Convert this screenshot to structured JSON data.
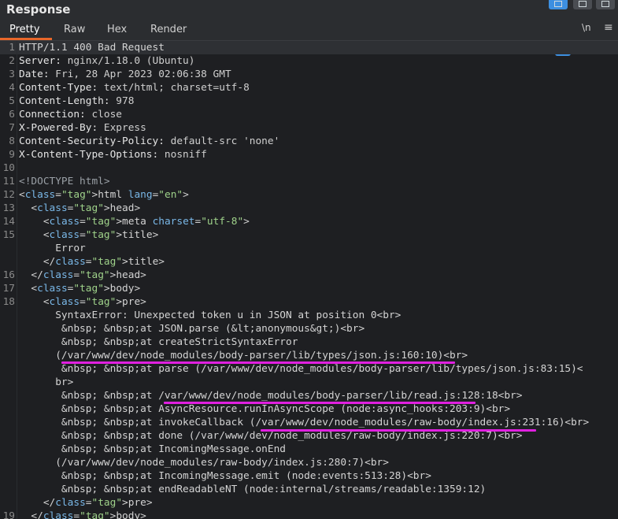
{
  "panel": {
    "title": "Response"
  },
  "tabs": [
    "Pretty",
    "Raw",
    "Hex",
    "Render"
  ],
  "toolbar": {
    "newline_label": "\\n",
    "menu_label": "≡"
  },
  "colors": {
    "accent_tab": "#e8672a",
    "underline": "#e020e0",
    "wrap_active": "#3d8fe0"
  },
  "lines": [
    {
      "n": "1",
      "t": "HTTP/1.1 400 Bad Request"
    },
    {
      "n": "2",
      "k": "Server:",
      "v": " nginx/1.18.0 (Ubuntu)"
    },
    {
      "n": "3",
      "k": "Date:",
      "v": " Fri, 28 Apr 2023 02:06:38 GMT"
    },
    {
      "n": "4",
      "k": "Content-Type:",
      "v": " text/html; charset=utf-8"
    },
    {
      "n": "5",
      "k": "Content-Length:",
      "v": " 978"
    },
    {
      "n": "6",
      "k": "Connection:",
      "v": " close"
    },
    {
      "n": "7",
      "k": "X-Powered-By:",
      "v": " Express"
    },
    {
      "n": "8",
      "k": "Content-Security-Policy:",
      "v": " default-src 'none'"
    },
    {
      "n": "9",
      "k": "X-Content-Type-Options:",
      "v": " nosniff"
    },
    {
      "n": "10",
      "t": ""
    },
    {
      "n": "11",
      "t": "<!DOCTYPE html>"
    },
    {
      "n": "12",
      "t": "<html lang=\"en\">"
    },
    {
      "n": "13",
      "t": "  <head>"
    },
    {
      "n": "14",
      "t": "    <meta charset=\"utf-8\">"
    },
    {
      "n": "15",
      "t": "    <title>"
    },
    {
      "n": "",
      "t": "      Error"
    },
    {
      "n": "",
      "t": "    </title>"
    },
    {
      "n": "16",
      "t": "  </head>"
    },
    {
      "n": "17",
      "t": "  <body>"
    },
    {
      "n": "18",
      "t": "    <pre>"
    },
    {
      "n": "",
      "t": "      SyntaxError: Unexpected token u in JSON at position 0<br>"
    },
    {
      "n": "",
      "t": "       &nbsp; &nbsp;at JSON.parse (&lt;anonymous&gt;)<br>"
    },
    {
      "n": "",
      "t": "       &nbsp; &nbsp;at createStrictSyntaxError"
    },
    {
      "n": "",
      "t": "      (/var/www/dev/node_modules/body-parser/lib/types/json.js:160:10)<br>"
    },
    {
      "n": "",
      "t": "       &nbsp; &nbsp;at parse (/var/www/dev/node_modules/body-parser/lib/types/json.js:83:15)<"
    },
    {
      "n": "",
      "t": "      br>"
    },
    {
      "n": "",
      "t": "       &nbsp; &nbsp;at /var/www/dev/node_modules/body-parser/lib/read.js:128:18<br>"
    },
    {
      "n": "",
      "t": "       &nbsp; &nbsp;at AsyncResource.runInAsyncScope (node:async_hooks:203:9)<br>"
    },
    {
      "n": "",
      "t": "       &nbsp; &nbsp;at invokeCallback (/var/www/dev/node_modules/raw-body/index.js:231:16)<br>"
    },
    {
      "n": "",
      "t": "       &nbsp; &nbsp;at done (/var/www/dev/node_modules/raw-body/index.js:220:7)<br>"
    },
    {
      "n": "",
      "t": "       &nbsp; &nbsp;at IncomingMessage.onEnd"
    },
    {
      "n": "",
      "t": "      (/var/www/dev/node_modules/raw-body/index.js:280:7)<br>"
    },
    {
      "n": "",
      "t": "       &nbsp; &nbsp;at IncomingMessage.emit (node:events:513:28)<br>"
    },
    {
      "n": "",
      "t": "       &nbsp; &nbsp;at endReadableNT (node:internal/streams/readable:1359:12)"
    },
    {
      "n": "",
      "t": "    </pre>"
    },
    {
      "n": "19",
      "t": "  </body>"
    }
  ]
}
